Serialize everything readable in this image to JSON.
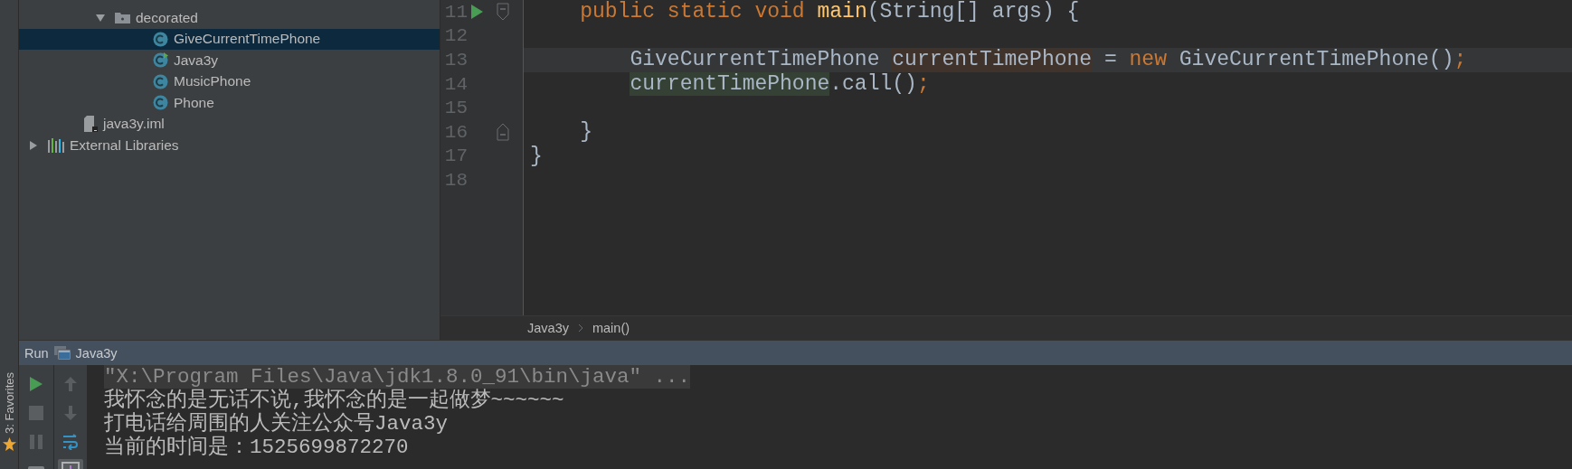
{
  "sidebar": {
    "label": "3: Favorites"
  },
  "project_tree": {
    "items": [
      {
        "kind": "folder",
        "label": "decorated",
        "expanded": true,
        "selected": false,
        "children": [
          {
            "kind": "class",
            "label": "GiveCurrentTimePhone",
            "selected": true,
            "runnable": false
          },
          {
            "kind": "class",
            "label": "Java3y",
            "selected": false,
            "runnable": true
          },
          {
            "kind": "class",
            "label": "MusicPhone",
            "selected": false,
            "runnable": false
          },
          {
            "kind": "class",
            "label": "Phone",
            "selected": false,
            "runnable": false
          }
        ]
      },
      {
        "kind": "file",
        "label": "java3y.iml",
        "selected": false
      },
      {
        "kind": "library",
        "label": "External Libraries",
        "expanded": false,
        "selected": false
      }
    ]
  },
  "editor": {
    "lines": [
      {
        "number": "11",
        "run_marker": true,
        "fold_open": true,
        "fold_close": false,
        "current": false,
        "tokens": [
          {
            "kind": "keyword",
            "text": "    public static void "
          },
          {
            "kind": "method",
            "text": "main"
          },
          {
            "kind": "plain",
            "text": "(String[] args) {"
          }
        ]
      },
      {
        "number": "12",
        "run_marker": false,
        "fold_open": false,
        "fold_close": false,
        "current": false
      },
      {
        "number": "13",
        "run_marker": false,
        "fold_open": false,
        "fold_close": false,
        "current": true,
        "tokens": [
          {
            "kind": "plain",
            "text": "        GiveCurrentTimePhone "
          },
          {
            "kind": "variable_write",
            "text": "currentTimePhone"
          },
          {
            "kind": "plain",
            "text": " = "
          },
          {
            "kind": "keyword",
            "text": "new"
          },
          {
            "kind": "plain",
            "text": " GiveCurrentTimePhone()"
          },
          {
            "kind": "keyword",
            "text": ";"
          }
        ]
      },
      {
        "number": "14",
        "run_marker": false,
        "fold_open": false,
        "fold_close": false,
        "current": false,
        "tokens": [
          {
            "kind": "variable_read",
            "text": "        currentTimePhone"
          },
          {
            "kind": "plain",
            "text": ".call()"
          },
          {
            "kind": "keyword",
            "text": ";"
          }
        ]
      },
      {
        "number": "15",
        "run_marker": false,
        "fold_open": false,
        "fold_close": false,
        "current": false
      },
      {
        "number": "16",
        "run_marker": false,
        "fold_open": false,
        "fold_close": true,
        "current": false,
        "tokens": [
          {
            "kind": "plain",
            "text": "    }"
          }
        ]
      },
      {
        "number": "17",
        "run_marker": false,
        "fold_open": false,
        "fold_close": false,
        "current": false,
        "tokens": [
          {
            "kind": "plain",
            "text": "}"
          }
        ]
      },
      {
        "number": "18",
        "run_marker": false,
        "fold_open": false,
        "fold_close": false,
        "current": false
      }
    ],
    "breadcrumbs": [
      "Java3y",
      "main()"
    ]
  },
  "run_panel": {
    "title": "Run",
    "configuration": "Java3y",
    "left_buttons": [
      {
        "kind": "run",
        "disabled": false
      },
      {
        "kind": "stop",
        "disabled": true
      },
      {
        "kind": "pause",
        "disabled": true
      },
      {
        "kind": "camera",
        "disabled": false
      }
    ],
    "right_buttons": [
      {
        "kind": "up",
        "disabled": true
      },
      {
        "kind": "down",
        "disabled": true
      },
      {
        "kind": "wrap",
        "disabled": false
      },
      {
        "kind": "scroll-end",
        "disabled": false,
        "pressed": true
      }
    ],
    "console": [
      {
        "kind": "command",
        "text": "\"X:\\Program Files\\Java\\jdk1.8.0_91\\bin\\java\" ..."
      },
      {
        "kind": "output",
        "text": "我怀念的是无话不说,我怀念的是一起做梦~~~~~~"
      },
      {
        "kind": "output",
        "text": "打电话给周围的人关注公众号Java3y"
      },
      {
        "kind": "output",
        "text": "当前的时间是：1525699872270"
      }
    ]
  }
}
